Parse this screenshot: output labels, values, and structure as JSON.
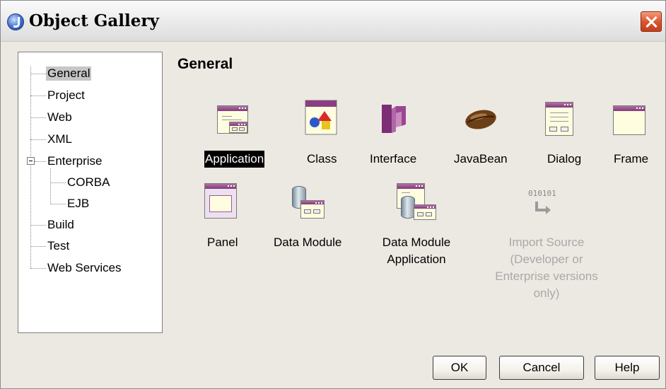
{
  "window": {
    "title": "Object Gallery"
  },
  "tree": {
    "items": [
      {
        "label": "General",
        "selected": true
      },
      {
        "label": "Project"
      },
      {
        "label": "Web"
      },
      {
        "label": "XML"
      },
      {
        "label": "Enterprise",
        "expanded": true
      },
      {
        "label": "CORBA"
      },
      {
        "label": "EJB"
      },
      {
        "label": "Build"
      },
      {
        "label": "Test"
      },
      {
        "label": "Web Services"
      }
    ]
  },
  "content": {
    "title": "General",
    "items": [
      {
        "label": "Application",
        "icon": "application-icon",
        "selected": true
      },
      {
        "label": "Class",
        "icon": "class-icon"
      },
      {
        "label": "Interface",
        "icon": "interface-icon"
      },
      {
        "label": "JavaBean",
        "icon": "javabean-icon"
      },
      {
        "label": "Dialog",
        "icon": "dialog-icon"
      },
      {
        "label": "Frame",
        "icon": "frame-icon"
      },
      {
        "label": "Panel",
        "icon": "panel-icon"
      },
      {
        "label": "Data Module",
        "icon": "data-module-icon"
      },
      {
        "label_lines": [
          "Data Module",
          "Application"
        ],
        "icon": "data-module-application-icon"
      },
      {
        "label_lines": [
          "Import Source",
          "(Developer or",
          "Enterprise versions",
          "only)"
        ],
        "icon": "import-source-icon",
        "disabled": true
      }
    ]
  },
  "buttons": {
    "ok": "OK",
    "cancel": "Cancel",
    "help": "Help"
  },
  "colors": {
    "selection": "#000000",
    "tree_selection": "#c6c6c6",
    "close_button": "#d8532c",
    "disabled_text": "#a9a9a9"
  }
}
